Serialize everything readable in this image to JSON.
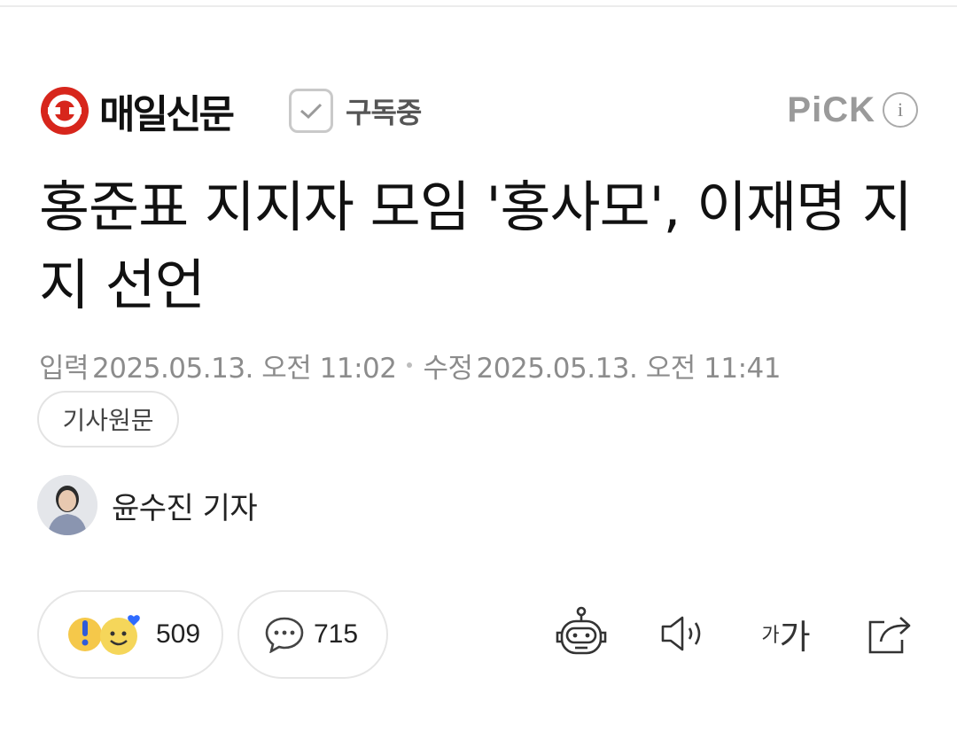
{
  "press": {
    "name": "매일신문",
    "subscribe_label": "구독중",
    "pick_label": "PiCK",
    "info_label": "i",
    "brand_color": "#d7261c"
  },
  "article": {
    "headline": "홍준표 지지자 모임 '홍사모', 이재명 지지 선언",
    "input_label": "입력",
    "input_date": "2025.05.13. 오전 11:02",
    "modified_label": "수정",
    "modified_date": "2025.05.13. 오전 11:41",
    "original_button": "기사원문",
    "author": "윤수진 기자"
  },
  "actions": {
    "reactions_count": "509",
    "comments_count": "715",
    "font_small": "가",
    "font_big": "가",
    "icons": [
      "robot-summary-icon",
      "speaker-icon",
      "font-size-icon",
      "share-icon"
    ]
  }
}
